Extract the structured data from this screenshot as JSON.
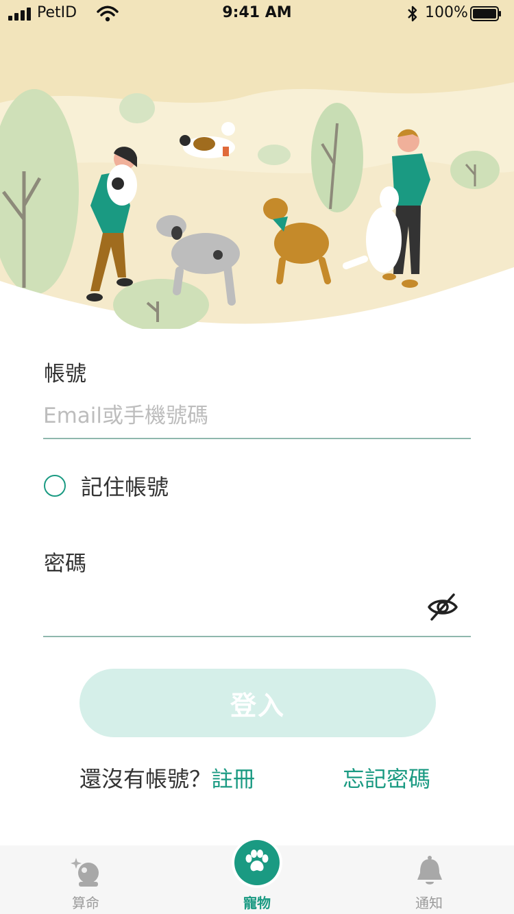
{
  "status_bar": {
    "carrier": "PetID",
    "time": "9:41 AM",
    "battery": "100%"
  },
  "form": {
    "account_label": "帳號",
    "account_placeholder": "Email或手機號碼",
    "remember_label": "記住帳號",
    "remember_checked": false,
    "password_label": "密碼",
    "password_value": "",
    "password_toggle_icon": "eye-off-icon",
    "login_button": "登入",
    "signup_prompt": "還沒有帳號？",
    "signup_link": "註冊",
    "forgot_link": "忘記密碼"
  },
  "tab_bar": {
    "items": [
      {
        "label": "算命",
        "icon": "crystal-ball-icon",
        "active": false
      },
      {
        "label": "寵物",
        "icon": "paw-icon",
        "active": true
      },
      {
        "label": "通知",
        "icon": "bell-icon",
        "active": false
      }
    ]
  },
  "colors": {
    "accent": "#1a9a82",
    "button_disabled": "#d5efe9",
    "hero_background": "#f3e6bd",
    "underline": "#8fb7ad"
  }
}
